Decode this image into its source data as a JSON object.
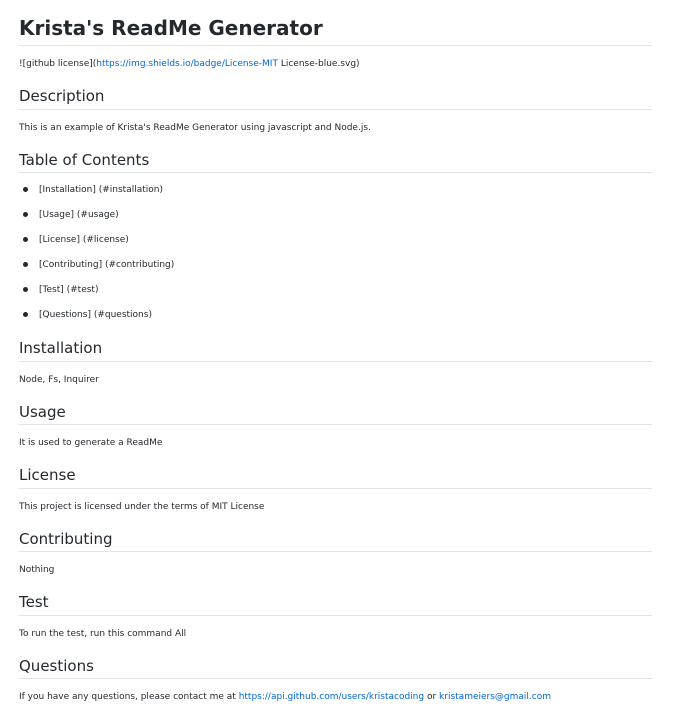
{
  "title": "Krista's ReadMe Generator",
  "badge": {
    "prefix": "![github license](",
    "link_text": "https://img.shields.io/badge/License-MIT",
    "suffix": " License-blue.svg)"
  },
  "sections": {
    "description": {
      "heading": "Description",
      "text": "This is an example of Krista's ReadMe Generator using javascript and Node.js."
    },
    "toc": {
      "heading": "Table of Contents",
      "items": [
        "[Installation] (#installation)",
        "[Usage] (#usage)",
        "[License] (#license)",
        "[Contributing] (#contributing)",
        "[Test] (#test)",
        "[Questions] (#questions)"
      ]
    },
    "installation": {
      "heading": "Installation",
      "text": "Node, Fs, Inquirer"
    },
    "usage": {
      "heading": "Usage",
      "text": "It is used to generate a ReadMe"
    },
    "license": {
      "heading": "License",
      "text": "This project is licensed under the terms of MIT License"
    },
    "contributing": {
      "heading": "Contributing",
      "text": "Nothing"
    },
    "test": {
      "heading": "Test",
      "text": "To run the test, run this command All"
    },
    "questions": {
      "heading": "Questions",
      "prefix": "If you have any questions, please contact me at ",
      "github_link": "https://api.github.com/users/kristacoding",
      "middle": " or ",
      "email_link": "kristameiers@gmail.com"
    }
  }
}
